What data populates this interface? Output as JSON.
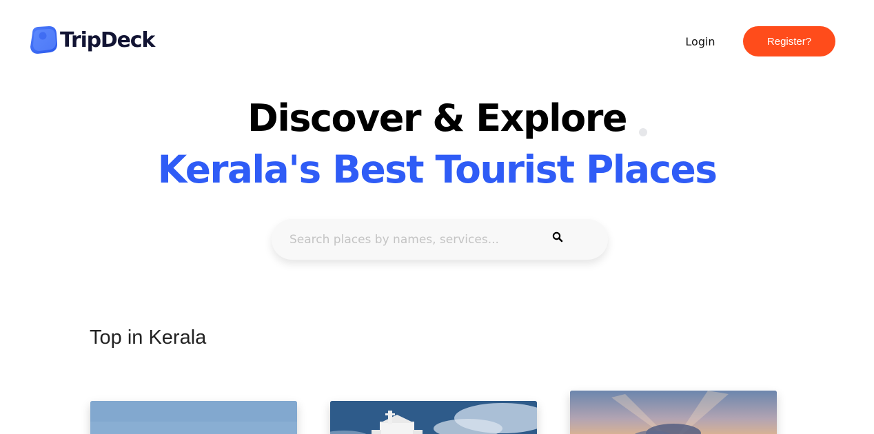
{
  "brand": {
    "name": "TripDeck",
    "accent_color": "#2f5cf6",
    "icon": "map-pin-icon"
  },
  "nav": {
    "login_label": "Login",
    "register_label": "Register?",
    "register_color": "#ff4c1b"
  },
  "hero": {
    "title": "Discover & Explore",
    "subtitle": "Kerala's Best Tourist Places"
  },
  "search": {
    "placeholder": "Search places by names, services...",
    "value": "",
    "icon": "search-icon"
  },
  "sections": [
    {
      "title": "Top in Kerala",
      "cards": [
        {
          "image": "blue-sky-photo"
        },
        {
          "image": "church-with-clouds-photo"
        },
        {
          "image": "sunset-clouds-photo"
        }
      ]
    }
  ]
}
